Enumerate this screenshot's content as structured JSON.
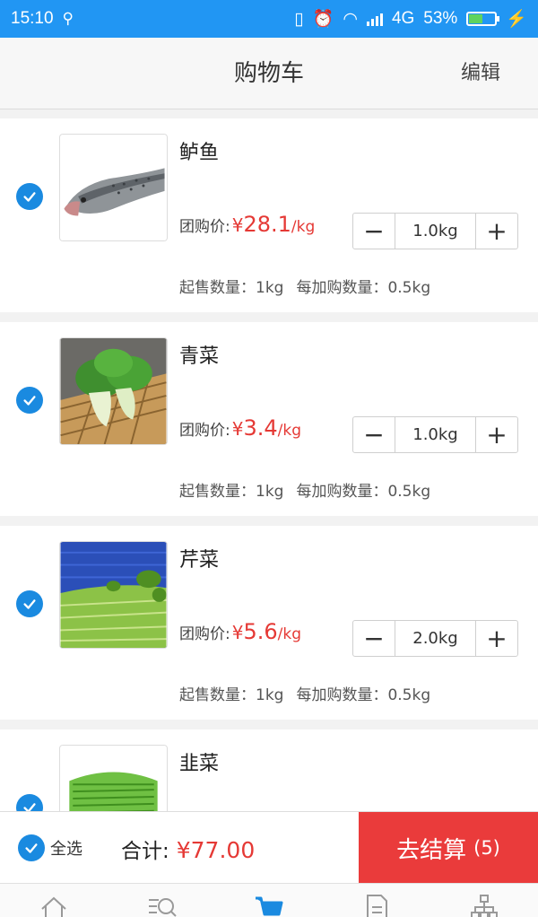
{
  "status": {
    "time": "15:10",
    "network": "4G",
    "battery": "53%",
    "battery_level": 0.53
  },
  "header": {
    "title": "购物车",
    "edit": "编辑"
  },
  "items": [
    {
      "name": "鲈鱼",
      "price_label": "团购价:",
      "currency": "¥",
      "price": "28.1",
      "unit": "/kg",
      "qty": "1.0kg",
      "min_label": "起售数量：1kg",
      "step_label": "每加购数量：0.5kg",
      "checked": true,
      "image": "fish-image"
    },
    {
      "name": "青菜",
      "price_label": "团购价:",
      "currency": "¥",
      "price": "3.4",
      "unit": "/kg",
      "qty": "1.0kg",
      "min_label": "起售数量：1kg",
      "step_label": "每加购数量：0.5kg",
      "checked": true,
      "image": "bok-choy-image"
    },
    {
      "name": "芹菜",
      "price_label": "团购价:",
      "currency": "¥",
      "price": "5.6",
      "unit": "/kg",
      "qty": "2.0kg",
      "min_label": "起售数量：1kg",
      "step_label": "每加购数量：0.5kg",
      "checked": true,
      "image": "celery-image"
    },
    {
      "name": "韭菜",
      "checked": true,
      "image": "chives-image"
    }
  ],
  "stepper": {
    "minus": "−",
    "plus": "+"
  },
  "footer": {
    "select_all": "全选",
    "total_label": "合计:",
    "total_amount": "¥77.00",
    "checkout": "去结算",
    "checkout_count": "(5)"
  },
  "tabs": [
    "home-icon",
    "search-list-icon",
    "cart-icon",
    "orders-icon",
    "org-icon"
  ],
  "colors": {
    "accent": "#1a8ae0",
    "price": "#e53935",
    "checkout": "#ea3b3b",
    "statusbar": "#2196f3",
    "active_tab": "#1a8ae0"
  }
}
